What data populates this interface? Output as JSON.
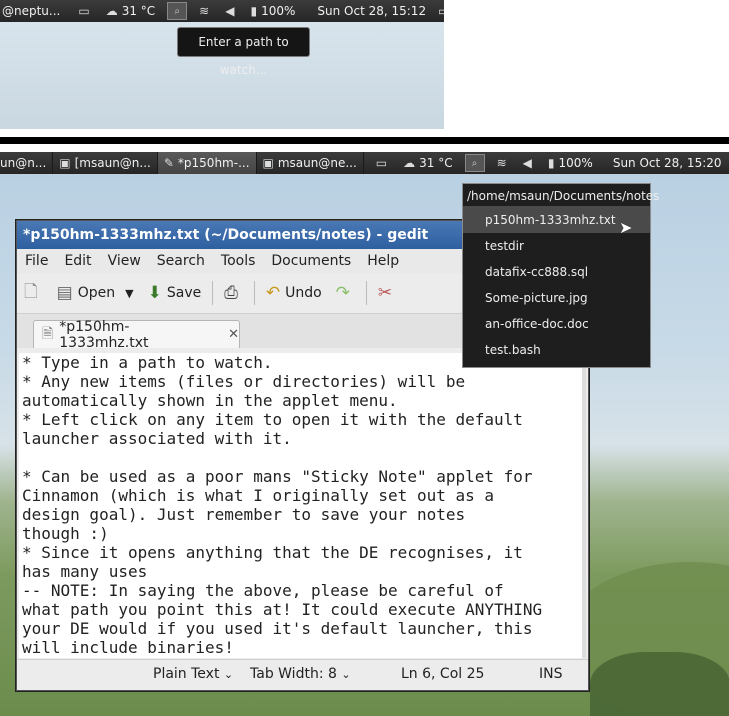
{
  "top_panel": {
    "user": "@neptu...",
    "temperature": "31 °C",
    "battery": "100%",
    "datetime": "Sun Oct 28, 15:12"
  },
  "tooltip": {
    "text": "Enter a path to watch..."
  },
  "bottom_panel": {
    "tasks": [
      {
        "label": "un@n...",
        "icon": "terminal-icon"
      },
      {
        "label": "[msaun@n...",
        "icon": "terminal-icon"
      },
      {
        "label": "*p150hm-...",
        "icon": "text-editor-icon"
      },
      {
        "label": "msaun@ne...",
        "icon": "terminal-icon"
      }
    ],
    "temperature": "31 °C",
    "battery": "100%",
    "datetime": "Sun Oct 28, 15:20"
  },
  "menu": {
    "header": "/home/msaun/Documents/notes",
    "items": [
      "p150hm-1333mhz.txt",
      "testdir",
      "datafix-cc888.sql",
      "Some-picture.jpg",
      "an-office-doc.doc",
      "test.bash"
    ],
    "highlighted_index": 0
  },
  "gedit": {
    "title": "*p150hm-1333mhz.txt (~/Documents/notes) - gedit",
    "menubar": [
      "File",
      "Edit",
      "View",
      "Search",
      "Tools",
      "Documents",
      "Help"
    ],
    "toolbar": {
      "open": "Open",
      "save": "Save",
      "undo": "Undo"
    },
    "tab_label": "*p150hm-1333mhz.txt",
    "text": "* Type in a path to watch.\n* Any new items (files or directories) will be\nautomatically shown in the applet menu.\n* Left click on any item to open it with the default\nlauncher associated with it.\n\n* Can be used as a poor mans \"Sticky Note\" applet for\nCinnamon (which is what I originally set out as a\ndesign goal). Just remember to save your notes\nthough :)\n* Since it opens anything that the DE recognises, it\nhas many uses\n-- NOTE: In saying the above, please be careful of\nwhat path you point this at! It could execute ANYTHING\nyour DE would if you used it's default launcher, this\nwill include binaries!",
    "status": {
      "syntax": "Plain Text",
      "tab_width": "Tab Width:  8",
      "position": "Ln 6, Col 25",
      "mode": "INS"
    }
  }
}
